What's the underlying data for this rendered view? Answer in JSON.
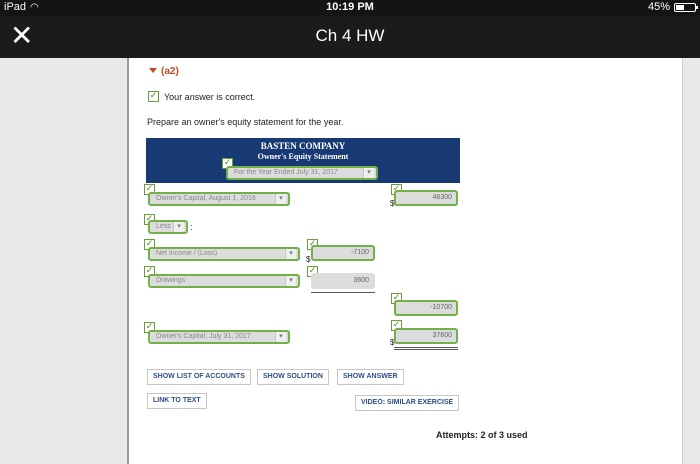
{
  "status_bar": {
    "device": "iPad",
    "time": "10:19 PM",
    "battery": "45%",
    "battery_level": 0.45,
    "icons": {
      "wifi": "wifi-icon",
      "battery": "battery-icon"
    }
  },
  "navbar": {
    "title": "Ch 4 HW",
    "close_glyph": "✕",
    "icons": {
      "close": "close-icon"
    }
  },
  "part_label": "(a2)",
  "check_glyph": "✓",
  "correct_text": "Your answer is correct.",
  "instruction": "Prepare an owner's equity statement for the year.",
  "statement": {
    "company": "BASTEN COMPANY",
    "name": "Owner's Equity Statement",
    "period": "For the Year Ended July 31, 2017",
    "opening_label": "Owner's Capital, August 1, 2016",
    "opening_value": "48300",
    "less_label": "Less",
    "less_colon": ":",
    "net_income_label": "Net Income / (Loss)",
    "net_income_value": "-7100",
    "drawings_label": "Drawings",
    "drawings_value": "3600",
    "total_less_value": "-10700",
    "closing_label": "Owner's Capital, July 31, 2017",
    "closing_value": "37600",
    "dollar": "$"
  },
  "buttons": {
    "list_accounts": "SHOW LIST OF ACCOUNTS",
    "show_solution": "SHOW SOLUTION",
    "show_answer": "SHOW ANSWER",
    "link_to_text": "LINK TO TEXT",
    "video": "VIDEO: SIMILAR EXERCISE"
  },
  "attempts": "Attempts: 2 of 3 used",
  "colors": {
    "header_bg": "#183a74",
    "accent_green": "#72b04a",
    "part_label": "#c44a1c",
    "link": "#2a4f86"
  }
}
